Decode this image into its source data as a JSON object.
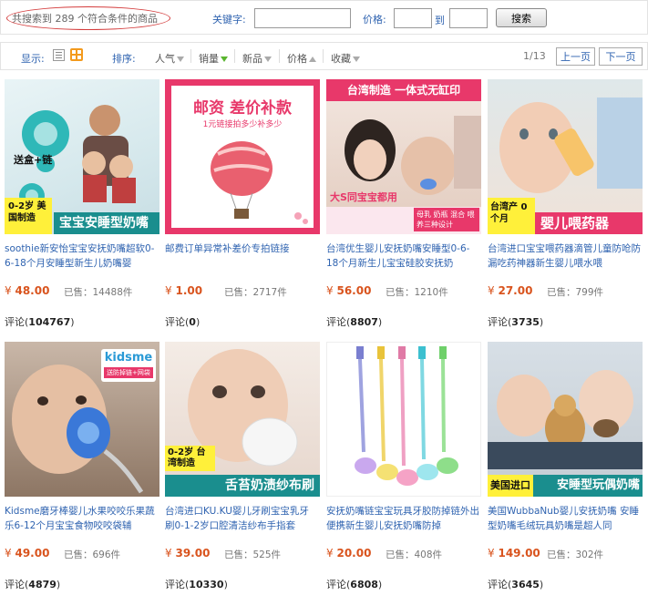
{
  "search": {
    "result_text": "共搜索到 289 个符合条件的商品",
    "keyword_label": "关键字:",
    "keyword_value": "",
    "price_label": "价格:",
    "price_to_label": "到",
    "price_min": "",
    "price_max": "",
    "search_button": "搜索"
  },
  "toolbar": {
    "show_label": "显示:",
    "sort_label": "排序:",
    "sorts": [
      {
        "label": "人气"
      },
      {
        "label": "销量"
      },
      {
        "label": "新品"
      },
      {
        "label": "价格"
      },
      {
        "label": "收藏"
      }
    ],
    "page": "1/13",
    "prev": "上一页",
    "next": "下一页"
  },
  "colors": {
    "link_blue": "#2f63b0",
    "price_red": "#d9541e",
    "view_grid_active": "#f39a1d",
    "sales_sort_active": "#5ab52f"
  },
  "products": [
    {
      "title": "soothie新安怡宝宝安抚奶嘴超软0-6-18个月安睡型新生儿奶嘴婴",
      "currency": "¥",
      "price": "48.00",
      "sold": "已售：14488件",
      "comments_label": "评论",
      "comments": "104767",
      "badge_age": "0-2岁 美国制造",
      "badge_text": "宝宝安睡型奶嘴",
      "extra_text": "送盒+链"
    },
    {
      "title": "邮费订单异常补差价专拍链接",
      "currency": "¥",
      "price": "1.00",
      "sold": "已售：2717件",
      "comments_label": "评论",
      "comments": "0",
      "headline": "邮资 差价补款",
      "subline": "1元链接拍多少补多少"
    },
    {
      "title": "台湾优生婴儿安抚奶嘴安睡型0-6-18个月新生儿宝宝硅胶安抚奶",
      "currency": "¥",
      "price": "56.00",
      "sold": "已售：1210件",
      "comments_label": "评论",
      "comments": "8807",
      "headline": "台湾制造 一体式无缸印",
      "overlay": "大S同宝宝都用",
      "subline": "母乳 奶瓶 混合 喂养三种设计"
    },
    {
      "title": "台湾进口宝宝喂药器滴管儿童防呛防漏吃药神器新生婴儿喂水喂",
      "currency": "¥",
      "price": "27.00",
      "sold": "已售：799件",
      "comments_label": "评论",
      "comments": "3735",
      "badge_age": "台湾产 0个月",
      "badge_text": "婴儿喂药器"
    },
    {
      "title": "Kidsme磨牙棒婴儿水果咬咬乐果蔬乐6-12个月宝宝食物咬咬袋辅",
      "currency": "¥",
      "price": "49.00",
      "sold": "已售：696件",
      "comments_label": "评论",
      "comments": "4879",
      "brand": "kidsme",
      "extra_text": "送防掉链+网袋"
    },
    {
      "title": "台湾进口KU.KU婴儿牙刷宝宝乳牙刷0-1-2岁口腔清洁纱布手指套",
      "currency": "¥",
      "price": "39.00",
      "sold": "已售：525件",
      "comments_label": "评论",
      "comments": "10330",
      "badge_age": "0-2岁 台湾制造",
      "badge_text": "舌苔奶渍纱布刷"
    },
    {
      "title": "安抚奶嘴链宝宝玩具牙胶防掉链外出便携新生婴儿安抚奶嘴防掉",
      "currency": "¥",
      "price": "20.00",
      "sold": "已售：408件",
      "comments_label": "评论",
      "comments": "6808"
    },
    {
      "title": "美国WubbaNub婴儿安抚奶嘴 安睡型奶嘴毛绒玩具奶嘴是超人同",
      "currency": "¥",
      "price": "149.00",
      "sold": "已售：302件",
      "comments_label": "评论",
      "comments": "3645",
      "badge_age": "美国进口",
      "badge_text": "安睡型玩偶奶嘴"
    }
  ]
}
